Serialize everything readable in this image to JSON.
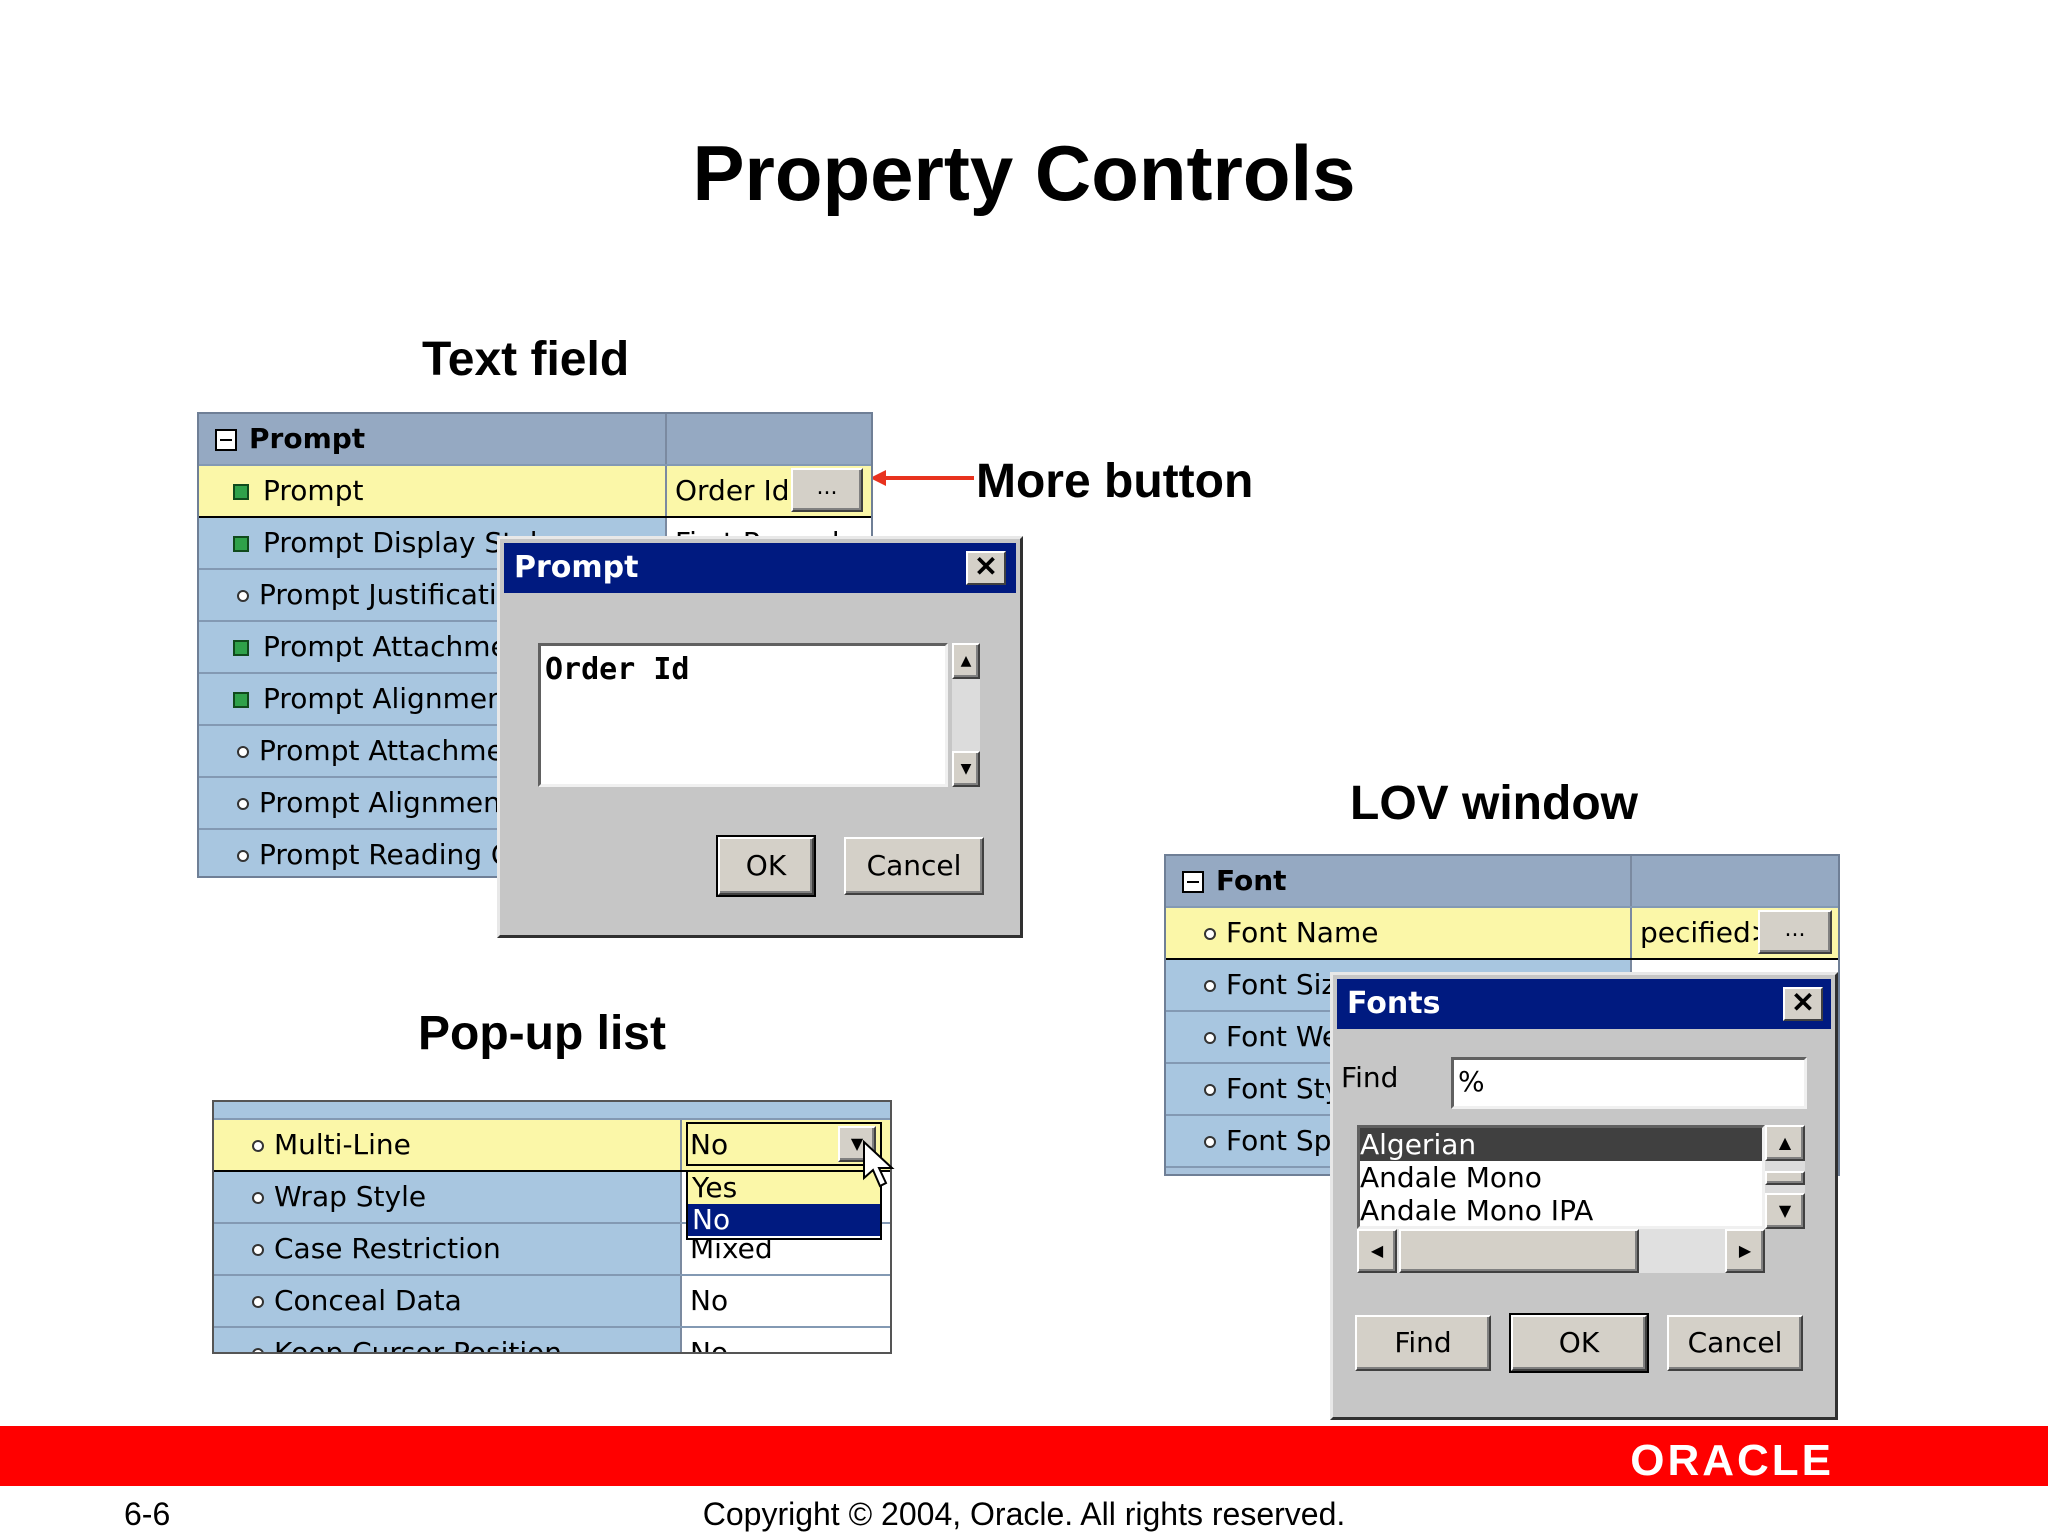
{
  "title": "Property Controls",
  "labels": {
    "text_field": "Text field",
    "more_button": "More button",
    "lov_window": "LOV window",
    "popup_list": "Pop-up list"
  },
  "prompt_grid": {
    "header": "Prompt",
    "rows": [
      {
        "name": "Prompt",
        "value": "Order Id"
      },
      {
        "name": "Prompt Display Style",
        "value": "First Record"
      },
      {
        "name": "Prompt Justification",
        "value": ""
      },
      {
        "name": "Prompt Attachment",
        "value": ""
      },
      {
        "name": "Prompt Alignment",
        "value": ""
      },
      {
        "name": "Prompt Attachment",
        "value": ""
      },
      {
        "name": "Prompt Alignment O",
        "value": ""
      },
      {
        "name": "Prompt Reading Or",
        "value": ""
      }
    ],
    "more_label": "..."
  },
  "prompt_dialog": {
    "title": "Prompt",
    "close_glyph": "✕",
    "text": "Order Id",
    "ok": "OK",
    "cancel": "Cancel"
  },
  "font_grid": {
    "header": "Font",
    "rows": [
      {
        "name": "Font Name",
        "value": "pecified>"
      },
      {
        "name": "Font Size",
        "value": ""
      },
      {
        "name": "Font We",
        "value": ""
      },
      {
        "name": "Font Styl",
        "value": ""
      },
      {
        "name": "Font Spa",
        "value": ""
      }
    ],
    "more_label": "..."
  },
  "fonts_dialog": {
    "title": "Fonts",
    "close_glyph": "✕",
    "find_label": "Find",
    "find_value": "%",
    "items": [
      "Algerian",
      "Andale Mono",
      "Andale Mono IPA"
    ],
    "find_button": "Find",
    "ok": "OK",
    "cancel": "Cancel"
  },
  "popup_grid": {
    "rows": [
      {
        "name": "Multi-Line",
        "value": "No"
      },
      {
        "name": "Wrap Style",
        "value": ""
      },
      {
        "name": "Case Restriction",
        "value": "Mixed"
      },
      {
        "name": "Conceal Data",
        "value": "No"
      },
      {
        "name": "Keep Cursor Position",
        "value": "No"
      }
    ],
    "options": [
      "Yes",
      "No"
    ]
  },
  "footer": {
    "brand": "ORACLE",
    "page": "6-6",
    "copyright": "Copyright © 2004, Oracle.  All rights reserved."
  },
  "colors": {
    "brand_red": "#ff0000",
    "titlebar": "#001a80",
    "selected_row": "#fbf7a8",
    "grid_name": "#a8c6e0",
    "arrow": "#e8321e"
  }
}
